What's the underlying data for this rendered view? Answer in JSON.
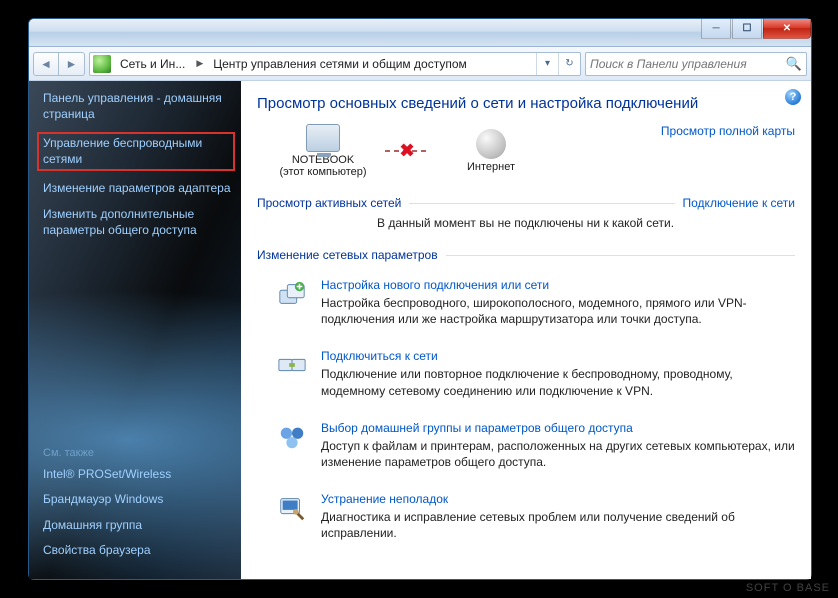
{
  "breadcrumb": {
    "part1": "Сеть и Ин...",
    "part2": "Центр управления сетями и общим доступом"
  },
  "search": {
    "placeholder": "Поиск в Панели управления"
  },
  "sidebar": {
    "home": "Панель управления - домашняя страница",
    "items": [
      "Управление беспроводными сетями",
      "Изменение параметров адаптера",
      "Изменить дополнительные параметры общего доступа"
    ],
    "seeAlsoTitle": "См. также",
    "seeAlso": [
      "Intel® PROSet/Wireless",
      "Брандмауэр Windows",
      "Домашняя группа",
      "Свойства браузера"
    ]
  },
  "main": {
    "heading": "Просмотр основных сведений о сети и настройка подключений",
    "fullMap": "Просмотр полной карты",
    "node1": "NOTEBOOK",
    "node1_sub": "(этот компьютер)",
    "node2": "Интернет",
    "activeTitle": "Просмотр активных сетей",
    "connectLink": "Подключение к сети",
    "noNetworks": "В данный момент вы не подключены ни к какой сети.",
    "changeTitle": "Изменение сетевых параметров",
    "items": [
      {
        "title": "Настройка нового подключения или сети",
        "desc": "Настройка беспроводного, широкополосного, модемного, прямого или VPN-подключения или же настройка маршрутизатора или точки доступа."
      },
      {
        "title": "Подключиться к сети",
        "desc": "Подключение или повторное подключение к беспроводному, проводному, модемному сетевому соединению или подключение к VPN."
      },
      {
        "title": "Выбор домашней группы и параметров общего доступа",
        "desc": "Доступ к файлам и принтерам, расположенных на других сетевых компьютерах, или изменение параметров общего доступа."
      },
      {
        "title": "Устранение неполадок",
        "desc": "Диагностика и исправление сетевых проблем или получение сведений об исправлении."
      }
    ]
  },
  "watermark": "SOFT O BASE"
}
